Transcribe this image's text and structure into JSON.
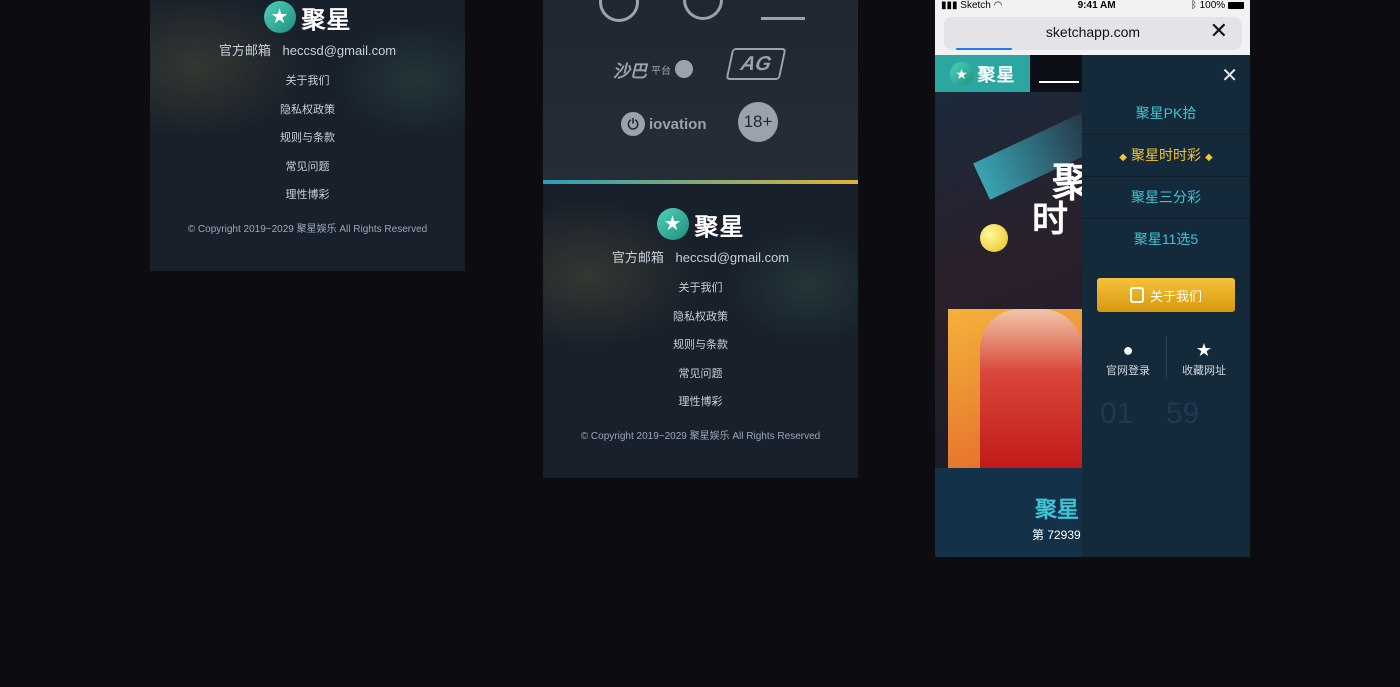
{
  "brand": {
    "name": "聚星",
    "logo_icon": "star-logo-icon"
  },
  "footer": {
    "email_label": "官方邮箱",
    "email": "heccsd@gmail.com",
    "links": [
      "关于我们",
      "隐私权政策",
      "规则与条款",
      "常见问题",
      "理性博彩"
    ],
    "copyright": "© Copyright 2019~2029 聚星娱乐 All Rights Reserved"
  },
  "partners": {
    "saba_main": "沙巴",
    "saba_sub": "平台",
    "ag": "AG",
    "iovation": "iovation",
    "age": "18+"
  },
  "phone": {
    "status": {
      "carrier": "Sketch",
      "time": "9:41 AM",
      "battery": "100%"
    },
    "url": "sketchapp.com",
    "hero": {
      "title_1": "聚",
      "title_2": "时",
      "bottom_title": "聚星",
      "issue": "第 72939"
    },
    "menu": {
      "items": [
        {
          "label": "聚星PK拾"
        },
        {
          "label": "聚星时时彩"
        },
        {
          "label": "聚星三分彩"
        },
        {
          "label": "聚星11选5"
        }
      ],
      "about_button": "关于我们",
      "login": "官网登录",
      "bookmark": "收藏网址"
    }
  },
  "colors": {
    "page_bg": "#0c0c11",
    "panel_bg": "#18202b",
    "accent_teal": "#3fc4d4",
    "accent_gold": "#f5c431",
    "menu_bg": "#142a3a"
  }
}
